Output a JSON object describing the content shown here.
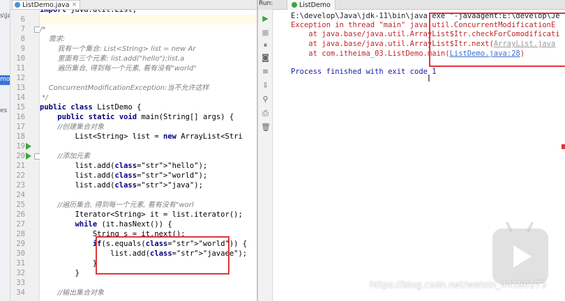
{
  "project_strip": {
    "items": [
      "s\\Ja",
      "mo",
      "es"
    ]
  },
  "editor": {
    "file_tab": "ListDemo.java",
    "lines": [
      {
        "n": "",
        "t": "import java.util.List;"
      },
      {
        "n": "6",
        "t": ""
      },
      {
        "n": "7",
        "t": "/*"
      },
      {
        "n": "8",
        "t": "    需求:"
      },
      {
        "n": "9",
        "t": "        我有一个集合: List<String> list = new Ar"
      },
      {
        "n": "10",
        "t": "        里面有三个元素: list.add(\"hello\");list.a"
      },
      {
        "n": "11",
        "t": "        遍历集合, 得到每一个元素, 看有没有\"world\""
      },
      {
        "n": "12",
        "t": ""
      },
      {
        "n": "13",
        "t": "    ConcurrentModificationException:当不允许这样"
      },
      {
        "n": "14",
        "t": " */"
      },
      {
        "n": "15",
        "t": "public class ListDemo {"
      },
      {
        "n": "16",
        "t": "    public static void main(String[] args) {"
      },
      {
        "n": "17",
        "t": "        //创建集合对象"
      },
      {
        "n": "18",
        "t": "        List<String> list = new ArrayList<Stri"
      },
      {
        "n": "19",
        "t": ""
      },
      {
        "n": "20",
        "t": "        //添加元素"
      },
      {
        "n": "21",
        "t": "        list.add(\"hello\");"
      },
      {
        "n": "22",
        "t": "        list.add(\"world\");"
      },
      {
        "n": "23",
        "t": "        list.add(\"java\");"
      },
      {
        "n": "24",
        "t": ""
      },
      {
        "n": "25",
        "t": "        //遍历集合, 得到每一个元素, 看有没有\"worl"
      },
      {
        "n": "26",
        "t": "        Iterator<String> it = list.iterator();"
      },
      {
        "n": "27",
        "t": "        while (it.hasNext()) {"
      },
      {
        "n": "28",
        "t": "            String s = it.next();"
      },
      {
        "n": "29",
        "t": "            if(s.equals(\"world\")) {"
      },
      {
        "n": "30",
        "t": "                list.add(\"javaee\");"
      },
      {
        "n": "31",
        "t": "            }"
      },
      {
        "n": "32",
        "t": "        }"
      },
      {
        "n": "33",
        "t": ""
      },
      {
        "n": "34",
        "t": "        //输出集合对象"
      }
    ]
  },
  "run": {
    "side_label": "Run:",
    "tab": "ListDemo",
    "console": {
      "cmd": "E:\\develop\\Java\\jdk-11\\bin\\java.exe \"-javaagent:E:\\develop\\Je",
      "exc": "Exception in thread \"main\" java.util.ConcurrentModificationE",
      "at1": "    at java.base/java.util.ArrayList$Itr.checkForComodificati",
      "at2_prefix": "    at java.base/java.util.ArrayList$Itr.next(",
      "at2_link": "ArrayList.java",
      "at3_prefix": "    at com.itheima_03.ListDemo.main(",
      "at3_link": "ListDemo.java:28",
      "at3_suffix": ")",
      "finish": "Process finished with exit code 1"
    }
  },
  "watermark": "https://blog.csdn.net/weixin_44180173",
  "colors": {
    "highlight_box": "#e0353b",
    "keyword": "#000080",
    "string": "#008000",
    "console_text": "#1a1aa6"
  }
}
